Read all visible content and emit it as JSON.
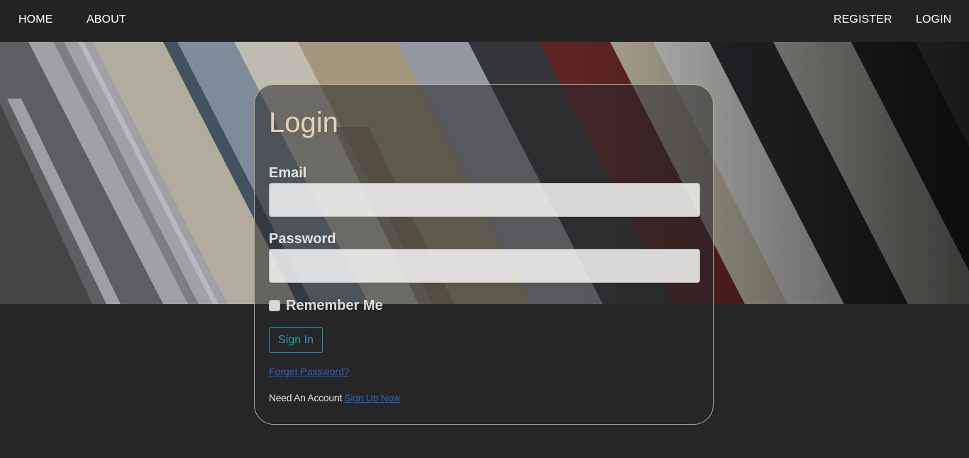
{
  "nav": {
    "home": "HOME",
    "about": "ABOUT",
    "register": "REGISTER",
    "login": "LOGIN"
  },
  "hero": {
    "image": "books-photo"
  },
  "form": {
    "title": "Login",
    "email_label": "Email",
    "email_value": "",
    "password_label": "Password",
    "password_value": "",
    "remember_label": "Remember Me",
    "remember_checked": false,
    "submit_label": "Sign In",
    "forget_link": "Forget Password?",
    "account_prompt": "Need An Account",
    "signup_link": "Sign Up Now"
  },
  "colors": {
    "page_bg": "#262626",
    "nav_bg": "#232323",
    "card_border": "#b8a98e",
    "title": "#e3d2b7",
    "button_accent": "#17a2b8",
    "link": "#2a63c8"
  }
}
